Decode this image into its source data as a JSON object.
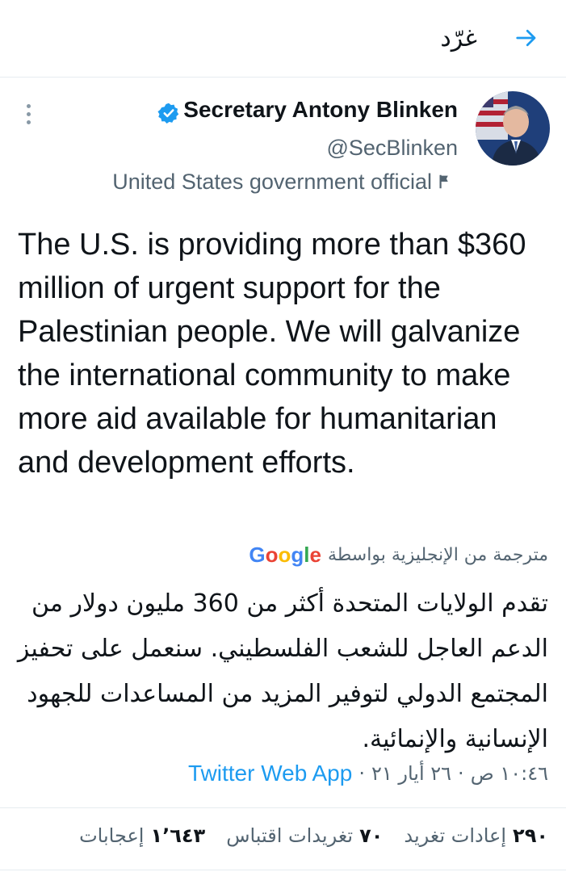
{
  "header": {
    "title": "غرّد",
    "back_icon": "arrow-right-icon"
  },
  "author": {
    "name": "Secretary Antony Blinken",
    "handle": "@SecBlinken",
    "label": "United States government official",
    "verified_icon": "verified-badge-icon",
    "flag_icon": "flag-icon",
    "accent_color": "#1d9bf0"
  },
  "tweet": {
    "text": "The U.S. is providing more than $360 million of urgent support for the Palestinian people. We will galvanize the international community to make more aid available for humanitarian and development efforts.",
    "translated_label": "مترجمة من الإنجليزية بواسطة",
    "translation_provider": "Google",
    "translation": "تقدم الولايات المتحدة أكثر من 360 مليون دولار من الدعم العاجل للشعب الفلسطيني. سنعمل على تحفيز المجتمع الدولي لتوفير المزيد من المساعدات للجهود الإنسانية والإنمائية.",
    "time": "١٠:٤٦ ص",
    "date": "٢٦ أيار ٢١",
    "source": "Twitter Web App"
  },
  "stats": {
    "retweets_count": "٢٩٠",
    "retweets_label": "إعادات تغريد",
    "quotes_count": "٧٠",
    "quotes_label": "تغريدات اقتباس",
    "likes_count": "١٬٦٤٣",
    "likes_label": "إعجابات"
  }
}
